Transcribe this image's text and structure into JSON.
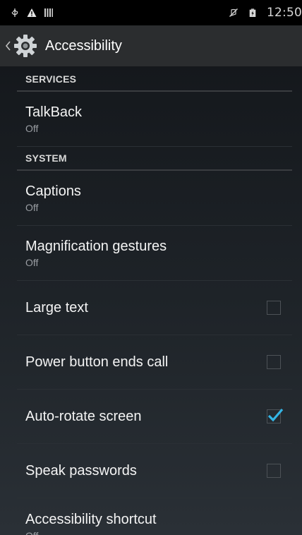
{
  "status_bar": {
    "time": "12:50",
    "left_icons": [
      "usb-icon",
      "warning-icon",
      "signal-bars-icon"
    ],
    "right_icons": [
      "muted-icon",
      "battery-icon"
    ]
  },
  "action_bar": {
    "title": "Accessibility",
    "icon": "settings-gear-icon"
  },
  "sections": [
    {
      "header": "SERVICES",
      "items": [
        {
          "title": "TalkBack",
          "summary": "Off"
        }
      ]
    },
    {
      "header": "SYSTEM",
      "items": [
        {
          "title": "Captions",
          "summary": "Off"
        },
        {
          "title": "Magnification gestures",
          "summary": "Off"
        },
        {
          "title": "Large text",
          "checkbox": false
        },
        {
          "title": "Power button ends call",
          "checkbox": false
        },
        {
          "title": "Auto-rotate screen",
          "checkbox": true
        },
        {
          "title": "Speak passwords",
          "checkbox": false
        },
        {
          "title": "Accessibility shortcut",
          "summary": "Off"
        }
      ]
    }
  ],
  "colors": {
    "accent": "#33b5e5",
    "status_bar": "#000000",
    "action_bar": "#2b2d2f"
  }
}
